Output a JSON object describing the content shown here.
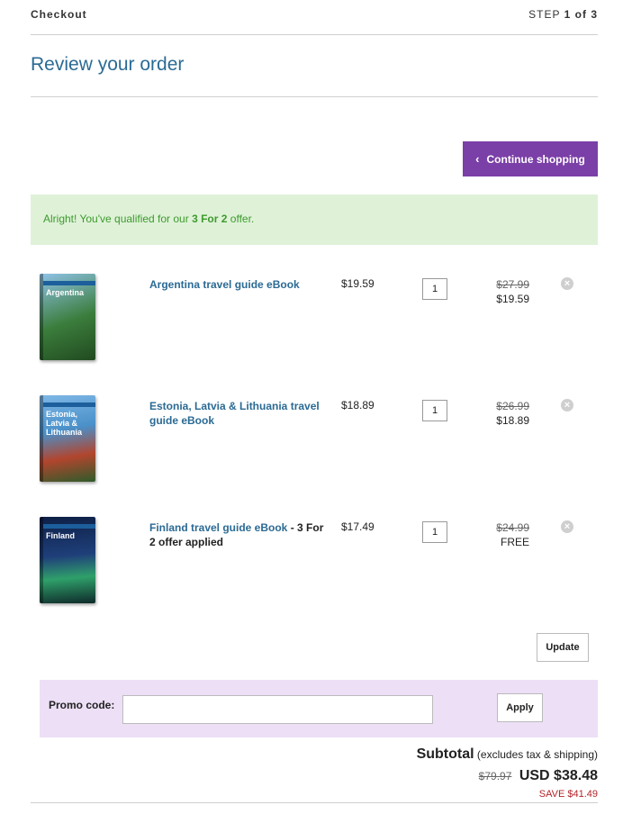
{
  "header": {
    "title": "Checkout",
    "step_prefix": "STEP",
    "step_current": "1",
    "step_of": "of",
    "step_total": "3"
  },
  "page_title": "Review your order",
  "continue_button": {
    "label": "Continue shopping",
    "icon": "chevron-left-icon"
  },
  "offer_banner": {
    "prefix": "Alright! You've qualified for our",
    "offer_name": "3 For 2",
    "suffix": "offer."
  },
  "items": [
    {
      "cover_title": "Argentina",
      "name": "Argentina travel guide eBook",
      "note": "",
      "price": "$19.59",
      "quantity": "1",
      "original_total": "$27.99",
      "line_total": "$19.59",
      "cover_color": "#3b7d3c"
    },
    {
      "cover_title": "Estonia, Latvia & Lithuania",
      "name": "Estonia, Latvia & Lithuania travel guide eBook",
      "note": "",
      "price": "$18.89",
      "quantity": "1",
      "original_total": "$26.99",
      "line_total": "$18.89",
      "cover_color": "#4a90c9"
    },
    {
      "cover_title": "Finland",
      "name": "Finland travel guide eBook",
      "note": " - 3 For 2 offer applied",
      "price": "$17.49",
      "quantity": "1",
      "original_total": "$24.99",
      "line_total": "FREE",
      "cover_color": "#1f3f7a"
    }
  ],
  "update_button": "Update",
  "promo": {
    "label": "Promo code:",
    "value": "",
    "placeholder": "",
    "apply_label": "Apply"
  },
  "summary": {
    "subtotal_label": "Subtotal",
    "subtotal_note": "(excludes tax & shipping)",
    "original": "$79.97",
    "total": "USD $38.48",
    "savings": "SAVE $41.49"
  },
  "colors": {
    "accent": "#7b3fa8",
    "link": "#2b6a94",
    "offer_bg": "#dff2d8",
    "offer_text": "#3e9a2e",
    "promo_bg": "#ecdff6",
    "save_text": "#b3242a"
  }
}
